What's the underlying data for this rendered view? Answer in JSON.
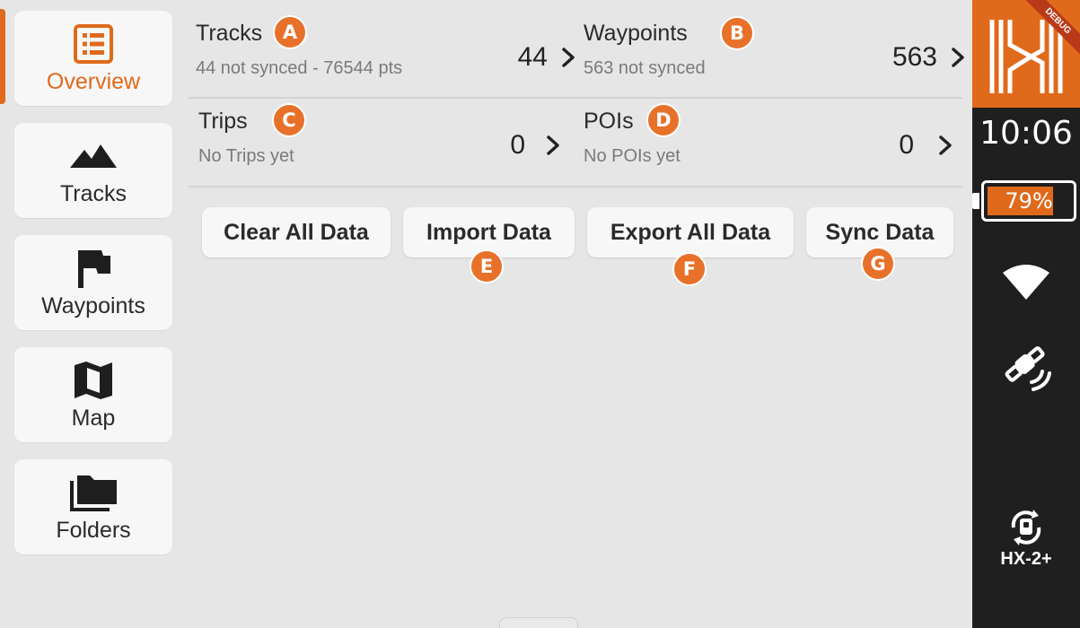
{
  "nav": {
    "items": [
      {
        "id": "overview",
        "label": "Overview",
        "icon": "list-icon",
        "active": true
      },
      {
        "id": "tracks",
        "label": "Tracks",
        "icon": "mountain-icon"
      },
      {
        "id": "waypoints",
        "label": "Waypoints",
        "icon": "flag-icon"
      },
      {
        "id": "map",
        "label": "Map",
        "icon": "map-icon"
      },
      {
        "id": "folders",
        "label": "Folders",
        "icon": "folder-icon"
      }
    ]
  },
  "stats": {
    "tracks": {
      "title": "Tracks",
      "subtitle": "44 not synced - 76544 pts",
      "count": "44",
      "badge": "A"
    },
    "waypoints": {
      "title": "Waypoints",
      "subtitle": "563 not synced",
      "count": "563",
      "badge": "B"
    },
    "trips": {
      "title": "Trips",
      "subtitle": "No Trips yet",
      "count": "0",
      "badge": "C"
    },
    "pois": {
      "title": "POIs",
      "subtitle": "No POIs yet",
      "count": "0",
      "badge": "D"
    }
  },
  "actions": {
    "clear": {
      "label": "Clear All Data"
    },
    "import": {
      "label": "Import Data",
      "badge": "E"
    },
    "export": {
      "label": "Export All Data",
      "badge": "F"
    },
    "sync": {
      "label": "Sync Data",
      "badge": "G"
    }
  },
  "status": {
    "debug_label": "DEBUG",
    "time": "10:06",
    "battery_text": "79%",
    "battery_level": 0.79,
    "device": "HX-2+",
    "icons": [
      "wifi-icon",
      "satellite-icon",
      "device-sync-icon"
    ]
  },
  "colors": {
    "accent": "#e06a1b",
    "badge": "#e8712a",
    "sidebar_dark": "#1f1f1f",
    "background": "#e6e6e6"
  }
}
